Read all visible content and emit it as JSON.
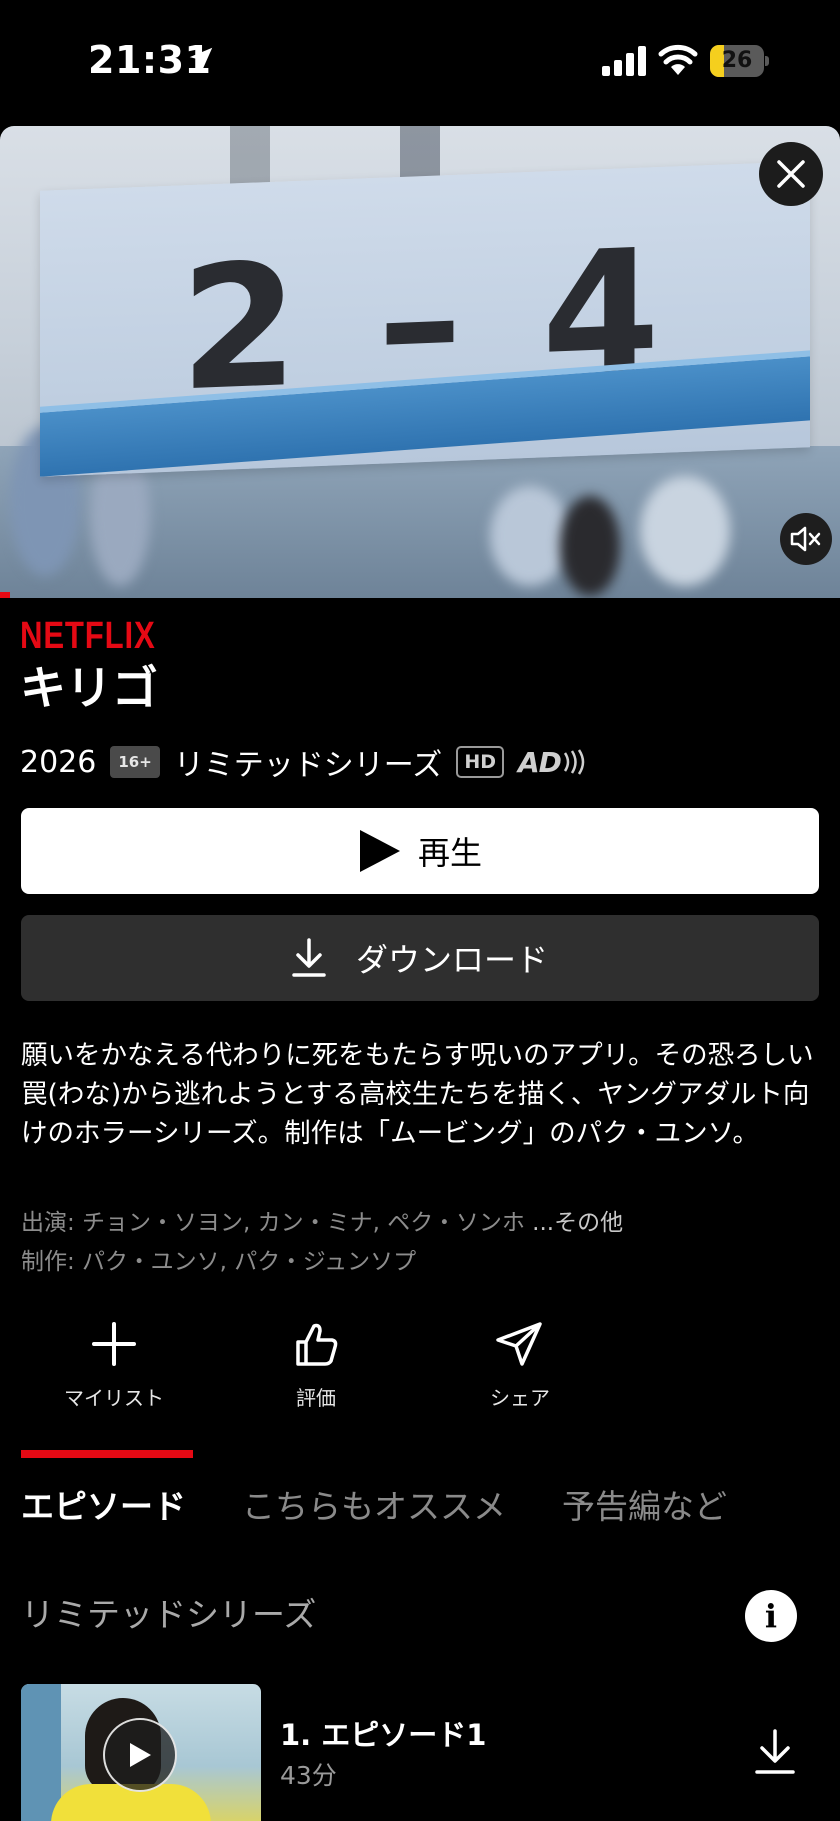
{
  "status_bar": {
    "time": "21:31",
    "battery": "26",
    "battery_level": 0.26
  },
  "hero": {
    "sign_text": "2 – 4",
    "accent_color": "#e50914"
  },
  "show": {
    "brand": "NETFLIX",
    "title": "キリゴ",
    "year": "2026",
    "rating": "16+",
    "type": "リミテッドシリーズ",
    "hd": "HD",
    "ad": "AD"
  },
  "buttons": {
    "play_label": "再生",
    "download_label": "ダウンロード"
  },
  "synopsis": "願いをかなえる代わりに死をもたらす呪いのアプリ。その恐ろしい罠(わな)から逃れようとする高校生たちを描く、ヤングアダルト向けのホラーシリーズ。制作は「ムービング」のパク・ユンソ。",
  "credits": {
    "cast": "出演: チョン・ソヨン, カン・ミナ, ペク・ソンホ",
    "cast_more": "...その他",
    "creators": "制作: パク・ユンソ, パク・ジュンソプ"
  },
  "actions": [
    {
      "label": "マイリスト",
      "icon": "plus-icon"
    },
    {
      "label": "評価",
      "icon": "thumbs-up-icon"
    },
    {
      "label": "シェア",
      "icon": "send-icon"
    }
  ],
  "tabs": [
    {
      "label": "エピソード",
      "active": true
    },
    {
      "label": "こちらもオススメ",
      "active": false
    },
    {
      "label": "予告編など",
      "active": false
    }
  ],
  "series_label": "リミテッドシリーズ",
  "episodes": [
    {
      "title": "1. エピソード1",
      "duration": "43分"
    }
  ]
}
